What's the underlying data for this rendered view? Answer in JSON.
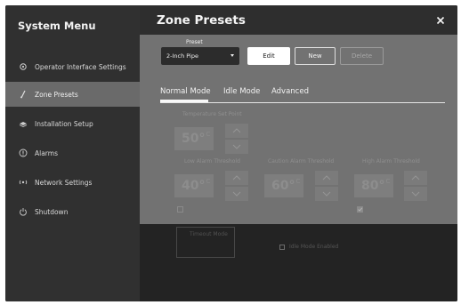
{
  "sidebar": {
    "title": "System Menu",
    "items": [
      {
        "label": "Operator Interface Settings",
        "icon": "gear-icon",
        "active": false
      },
      {
        "label": "Zone Presets",
        "icon": "pen-icon",
        "active": true
      },
      {
        "label": "Installation Setup",
        "icon": "install-icon",
        "active": false
      },
      {
        "label": "Alarms",
        "icon": "alert-icon",
        "active": false
      },
      {
        "label": "Network Settings",
        "icon": "network-icon",
        "active": false
      },
      {
        "label": "Shutdown",
        "icon": "power-icon",
        "active": false
      }
    ]
  },
  "header": {
    "title": "Zone Presets",
    "close_glyph": "×"
  },
  "preset": {
    "label": "Preset",
    "selected": "2-Inch Pipe",
    "edit_label": "Edit",
    "new_label": "New",
    "delete_label": "Delete"
  },
  "tabs": [
    {
      "label": "Normal Mode",
      "active": true
    },
    {
      "label": "Idle Mode",
      "active": false
    },
    {
      "label": "Advanced",
      "active": false
    }
  ],
  "fields": {
    "temperature": {
      "label": "Temperature",
      "suffix": "Set Point",
      "value": "50°",
      "unit": "C"
    },
    "low_alarm": {
      "label": "Low Alarm",
      "suffix": "Threshold",
      "value": "40°",
      "unit": "C",
      "enabled": false
    },
    "caution_alarm": {
      "label": "Caution Alarm",
      "suffix": "Threshold",
      "value": "60°",
      "unit": "C"
    },
    "high_alarm": {
      "label": "High Alarm",
      "suffix": "Threshold",
      "value": "80°",
      "unit": "C",
      "enabled": true
    }
  },
  "lower": {
    "timeout_label": "Timeout Mode",
    "idle_mode_label": "Idle Mode Enabled"
  },
  "colors": {
    "frame_bg": "#2b2b2b",
    "sidebar_bg": "#303030",
    "active_item_bg": "#6a6a6a",
    "panel_bg": "#727272"
  }
}
